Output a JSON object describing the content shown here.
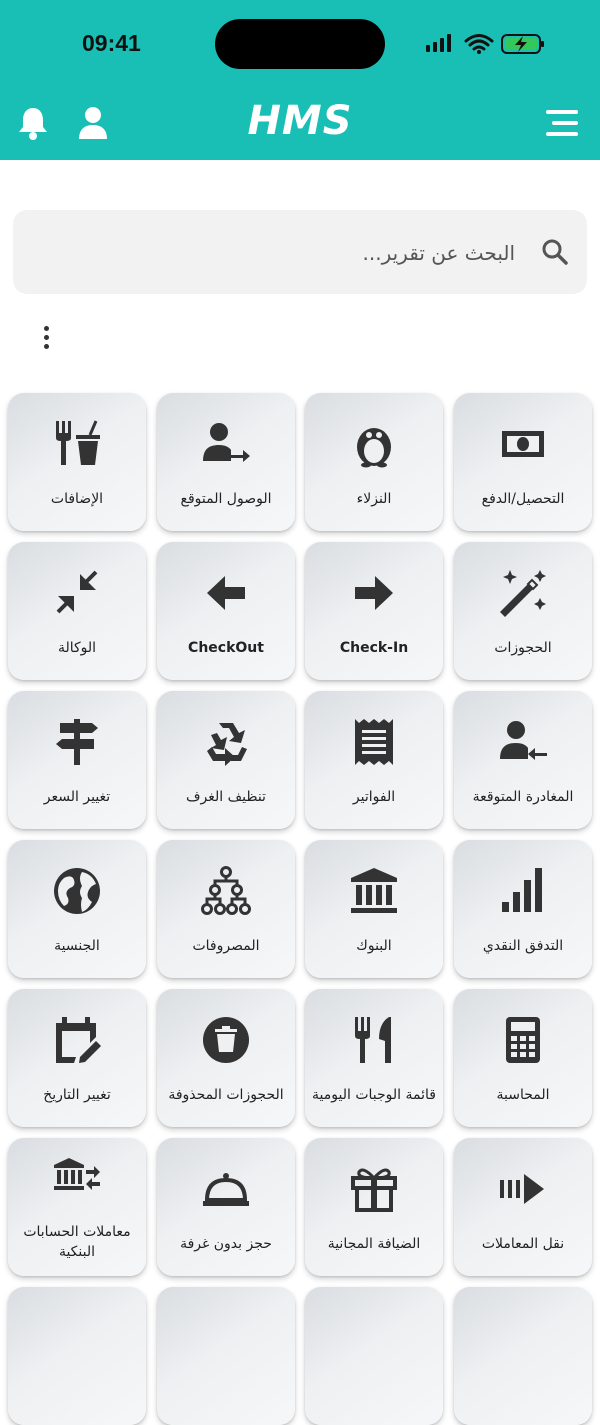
{
  "status_bar": {
    "time": "09:41"
  },
  "header": {
    "brand": "HMS"
  },
  "search": {
    "placeholder": "البحث عن تقرير..."
  },
  "tiles": [
    {
      "label": "التحصيل/الدفع",
      "icon": "cash-icon"
    },
    {
      "label": "النزلاء",
      "icon": "penguin-icon"
    },
    {
      "label": "الوصول المتوقع",
      "icon": "user-arrow-right-icon"
    },
    {
      "label": "الإضافات",
      "icon": "fork-drink-icon"
    },
    {
      "label": "الحجوزات",
      "icon": "magic-wand-icon"
    },
    {
      "label": "Check-In",
      "icon": "arrow-right-icon"
    },
    {
      "label": "CheckOut",
      "icon": "arrow-left-icon"
    },
    {
      "label": "الوكالة",
      "icon": "compress-icon"
    },
    {
      "label": "المغادرة المتوقعة",
      "icon": "user-arrow-left-icon"
    },
    {
      "label": "الفواتير",
      "icon": "receipt-icon"
    },
    {
      "label": "تنظيف الغرف",
      "icon": "recycle-icon"
    },
    {
      "label": "تغيير السعر",
      "icon": "signpost-icon"
    },
    {
      "label": "التدفق النقدي",
      "icon": "signal-bars-icon"
    },
    {
      "label": "البنوك",
      "icon": "bank-icon"
    },
    {
      "label": "المصروفات",
      "icon": "hierarchy-icon"
    },
    {
      "label": "الجنسية",
      "icon": "globe-icon"
    },
    {
      "label": "المحاسبة",
      "icon": "calculator-icon"
    },
    {
      "label": "قائمة الوجبات اليومية",
      "icon": "utensils-icon"
    },
    {
      "label": "الحجوزات المحذوفة",
      "icon": "trash-icon"
    },
    {
      "label": "تغيير التاريخ",
      "icon": "calendar-edit-icon"
    },
    {
      "label": "نقل المعاملات",
      "icon": "transfer-arrow-icon"
    },
    {
      "label": "الضيافة المجانية",
      "icon": "gift-icon"
    },
    {
      "label": "حجز بدون غرفة",
      "icon": "cloche-icon"
    },
    {
      "label": "معاملات الحسابات البنكية",
      "icon": "bank-transfer-icon"
    }
  ],
  "colors": {
    "accent": "#19bfb5",
    "icon": "#333333"
  }
}
